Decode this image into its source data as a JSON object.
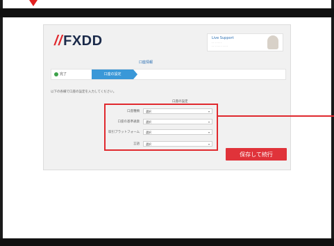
{
  "brand": {
    "logo_mark": "//",
    "logo_text": "FXDD"
  },
  "support": {
    "title": "Live Support",
    "line1": "· · · · · · ·",
    "line2": "· · · · · · · · · · ·"
  },
  "section": {
    "label": "口座情報"
  },
  "steps": [
    {
      "label": "完了"
    },
    {
      "label": "口座の設定"
    }
  ],
  "instruction": "以下の各欄で口座の設定を入力してください。",
  "form": {
    "heading": "口座の設定",
    "fields": [
      {
        "label": "口座種類",
        "value": "選択"
      },
      {
        "label": "口座の基準通貨",
        "value": "選択"
      },
      {
        "label": "取引プラットフォーム",
        "value": "選択"
      },
      {
        "label": "言語",
        "value": "選択"
      }
    ]
  },
  "actions": {
    "save_label": "保存して続行"
  },
  "colors": {
    "accent_red": "#e0282d",
    "step_blue": "#3a98d8",
    "logo_navy": "#1b2a4a"
  }
}
